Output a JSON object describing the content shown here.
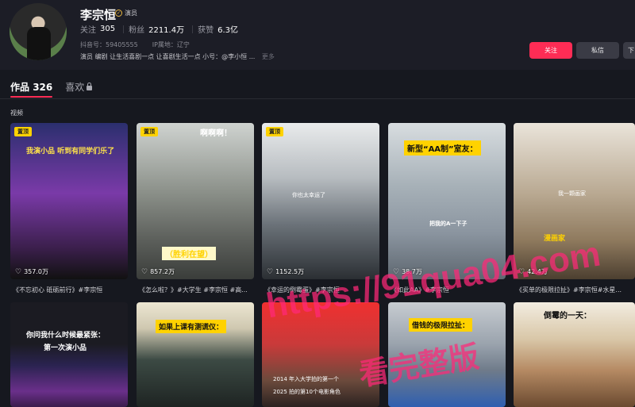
{
  "profile": {
    "name": "李宗恒",
    "badge_label": "演员",
    "stats": [
      {
        "label": "关注",
        "value": "305"
      },
      {
        "label": "粉丝",
        "value": "2211.4万"
      },
      {
        "label": "获赞",
        "value": "6.3亿"
      }
    ],
    "account_id": "抖音号：59405555",
    "ip_location": "IP属地：辽宁",
    "bio": "演员 编剧 让生活喜剧一点 让喜剧生活一点 小号：@李小恒 ...",
    "bio_more": "更多"
  },
  "actions": {
    "follow": "关注",
    "message": "私信",
    "more": "下"
  },
  "tabs": {
    "works_label": "作品",
    "works_count": "326",
    "likes_label": "喜欢"
  },
  "section_label": "视频",
  "row1": [
    {
      "pinned": "置顶",
      "overlay": "我演小品 听到有同学们乐了",
      "likes": "357.0万",
      "caption": "《不忘初心 砥砺前行》#李宗恒",
      "bg": "#7a3aa8"
    },
    {
      "pinned": "置顶",
      "overlay": "啊啊啊！",
      "overlay2": "（胜利在望）",
      "likes": "857.2万",
      "caption": "《怎么啦？》#大学生 #李宗恒 #高...",
      "bg": "#8a8f88"
    },
    {
      "pinned": "置顶",
      "overlay": "你也太幸运了",
      "likes": "1152.5万",
      "caption": "《幸运的倒霉蛋》#李宗恒",
      "bg": "#6b7279"
    },
    {
      "pinned": "",
      "overlay": "新型“AA制”室友：",
      "overlay2": "把我的A一下子",
      "likes": "38.7万",
      "caption": "《如此AA》#李宗恒",
      "bg": "#a7b1b8"
    },
    {
      "pinned": "",
      "overlay": "我一颗画家",
      "overlay2": "漫画家",
      "likes": "42.4万",
      "caption": "《买单的极限拉扯》#李宗恒#水星...",
      "bg": "#b9a992"
    }
  ],
  "row2": [
    {
      "overlay": "你问我什么时候最紧张：",
      "overlay2": "第一次演小品",
      "bg": "#2a2350"
    },
    {
      "overlay": "如果上课有测谎仪：",
      "bg": "#3c4a44"
    },
    {
      "overlay": "2014 年入大学拍的第一个",
      "overlay2": "2025 拍的第10个电影角色",
      "bg": "#c93a3a"
    },
    {
      "overlay": "借钱的极限拉扯：",
      "bg": "#6f7b8a"
    },
    {
      "overlay": "倒霉的一天：",
      "bg": "#b58a63"
    }
  ],
  "watermark": {
    "line1": "https://91qua04.com",
    "line2": "看完整版"
  }
}
